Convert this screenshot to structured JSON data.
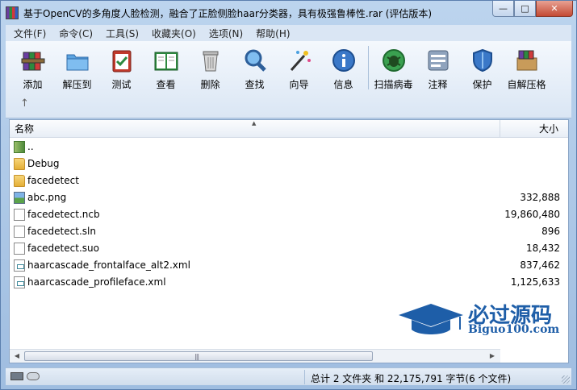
{
  "window": {
    "title": "基于OpenCV的多角度人脸检测，融合了正脸侧脸haar分类器，具有极强鲁棒性.rar (评估版本)",
    "controls": {
      "minimize": "—",
      "maximize": "□",
      "close": "✕"
    }
  },
  "menu": {
    "items": [
      "文件(F)",
      "命令(C)",
      "工具(S)",
      "收藏夹(O)",
      "选项(N)",
      "帮助(H)"
    ]
  },
  "toolbar": {
    "buttons": [
      {
        "label": "添加",
        "icon": "books-add-icon"
      },
      {
        "label": "解压到",
        "icon": "folder-extract-icon"
      },
      {
        "label": "测试",
        "icon": "clipboard-check-icon"
      },
      {
        "label": "查看",
        "icon": "open-book-icon"
      },
      {
        "label": "删除",
        "icon": "trash-can-icon"
      },
      {
        "label": "查找",
        "icon": "magnifier-icon"
      },
      {
        "label": "向导",
        "icon": "magic-wand-icon"
      },
      {
        "label": "信息",
        "icon": "info-icon"
      },
      {
        "label": "扫描病毒",
        "icon": "bug-scan-icon"
      },
      {
        "label": "注释",
        "icon": "comment-icon"
      },
      {
        "label": "保护",
        "icon": "shield-icon"
      },
      {
        "label": "自解压格",
        "icon": "sfx-box-icon"
      }
    ],
    "up_arrow": "↑"
  },
  "file_list": {
    "columns": {
      "name": "名称",
      "size": "大小"
    },
    "rows": [
      {
        "name": "..",
        "size": "",
        "type": "updir"
      },
      {
        "name": "Debug",
        "size": "",
        "type": "folder"
      },
      {
        "name": "facedetect",
        "size": "",
        "type": "folder"
      },
      {
        "name": "abc.png",
        "size": "332,888",
        "type": "png"
      },
      {
        "name": "facedetect.ncb",
        "size": "19,860,480",
        "type": "doc"
      },
      {
        "name": "facedetect.sln",
        "size": "896",
        "type": "doc"
      },
      {
        "name": "facedetect.suo",
        "size": "18,432",
        "type": "doc"
      },
      {
        "name": "haarcascade_frontalface_alt2.xml",
        "size": "837,462",
        "type": "xml"
      },
      {
        "name": "haarcascade_profileface.xml",
        "size": "1,125,633",
        "type": "xml"
      }
    ]
  },
  "watermark": {
    "title": "必过源码",
    "subtitle": "Biguo100.com"
  },
  "status": {
    "summary": "总计 2 文件夹 和 22,175,791 字节(6 个文件)"
  },
  "colors": {
    "accent": "#1e5ea8",
    "window_frame": "#bcd4ee"
  }
}
